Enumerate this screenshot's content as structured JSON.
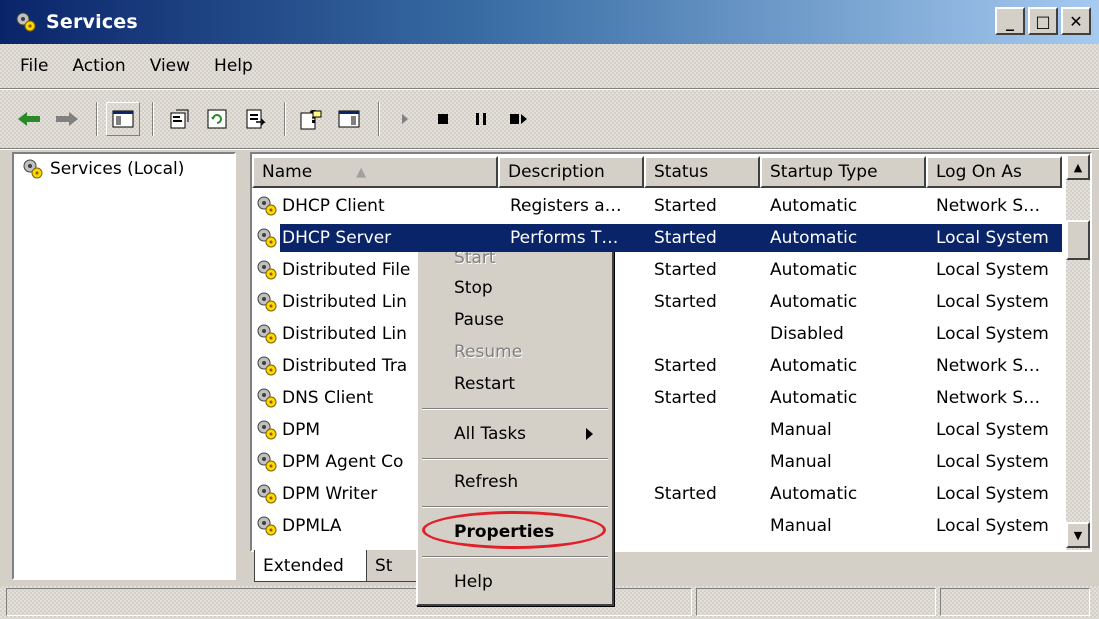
{
  "window": {
    "title": "Services",
    "minimize_label": "_",
    "maximize_label": "□",
    "close_label": "✕"
  },
  "menu": [
    "File",
    "Action",
    "View",
    "Help"
  ],
  "toolbar": {
    "icons": [
      "back-arrow-icon",
      "forward-arrow-icon",
      "show-hide-tree-icon",
      "properties-icon",
      "refresh-icon",
      "export-list-icon",
      "help-icon",
      "console-tree-icon",
      "start-service-icon",
      "stop-service-icon",
      "pause-service-icon",
      "restart-service-icon"
    ]
  },
  "tree": {
    "root_label": "Services (Local)"
  },
  "list": {
    "columns": [
      "Name",
      "Description",
      "Status",
      "Startup Type",
      "Log On As"
    ],
    "rows": [
      {
        "name": "DHCP Client",
        "description": "Registers a…",
        "status": "Started",
        "startup": "Automatic",
        "logon": "Network S…"
      },
      {
        "name": "DHCP Server",
        "description": "Performs T…",
        "status": "Started",
        "startup": "Automatic",
        "logon": "Local System"
      },
      {
        "name": "Distributed File",
        "description": "…",
        "status": "Started",
        "startup": "Automatic",
        "logon": "Local System"
      },
      {
        "name": "Distributed Lin",
        "description": ".",
        "status": "Started",
        "startup": "Automatic",
        "logon": "Local System"
      },
      {
        "name": "Distributed Lin",
        "description": "..",
        "status": "",
        "startup": "Disabled",
        "logon": "Local System"
      },
      {
        "name": "Distributed Tra",
        "description": "..",
        "status": "Started",
        "startup": "Automatic",
        "logon": "Network S…"
      },
      {
        "name": "DNS Client",
        "description": "..",
        "status": "Started",
        "startup": "Automatic",
        "logon": "Network S…"
      },
      {
        "name": "DPM",
        "description": "..",
        "status": "",
        "startup": "Manual",
        "logon": "Local System"
      },
      {
        "name": "DPM Agent Co",
        "description": "..",
        "status": "",
        "startup": "Manual",
        "logon": "Local System"
      },
      {
        "name": "DPM Writer",
        "description": "..",
        "status": "Started",
        "startup": "Automatic",
        "logon": "Local System"
      },
      {
        "name": "DPMLA",
        "description": "..",
        "status": "",
        "startup": "Manual",
        "logon": "Local System"
      }
    ]
  },
  "tabs": [
    "Extended",
    "St"
  ],
  "context_menu": {
    "start": "Start",
    "stop": "Stop",
    "pause": "Pause",
    "resume": "Resume",
    "restart": "Restart",
    "all_tasks": "All Tasks",
    "refresh": "Refresh",
    "properties": "Properties",
    "help": "Help"
  },
  "colors": {
    "titlebar": "#0a246a",
    "selection": "#0a246a",
    "highlight_ring": "#e0202a"
  }
}
